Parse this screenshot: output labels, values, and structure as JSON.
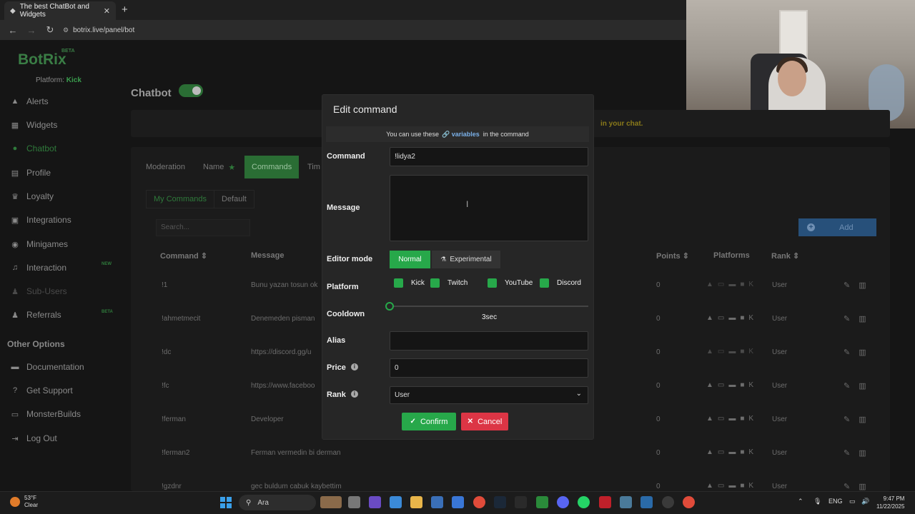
{
  "browser": {
    "tab_title": "The best ChatBot and Widgets",
    "url": "botrix.live/panel/bot"
  },
  "sidebar": {
    "logo": "BotRix",
    "beta": "BETA",
    "platform_label": "Platform:",
    "platform_value": "Kick",
    "items": [
      {
        "label": "Alerts",
        "icon": "warning-icon"
      },
      {
        "label": "Widgets",
        "icon": "grid-icon"
      },
      {
        "label": "Chatbot",
        "icon": "robot-icon"
      },
      {
        "label": "Profile",
        "icon": "id-card-icon"
      },
      {
        "label": "Loyalty",
        "icon": "trophy-icon"
      },
      {
        "label": "Integrations",
        "icon": "integrations-icon"
      },
      {
        "label": "Minigames",
        "icon": "gamepad-icon"
      },
      {
        "label": "Interaction",
        "icon": "music-icon"
      },
      {
        "label": "Sub-Users",
        "icon": "users-icon"
      },
      {
        "label": "Referrals",
        "icon": "referrals-icon"
      }
    ],
    "interaction_tag": "NEW",
    "referrals_tag": "BETA",
    "other_heading": "Other Options",
    "other_items": [
      {
        "label": "Documentation",
        "icon": "book-icon"
      },
      {
        "label": "Get Support",
        "icon": "question-icon"
      },
      {
        "label": "MonsterBuilds",
        "icon": "monitor-icon"
      },
      {
        "label": "Log Out",
        "icon": "logout-icon"
      }
    ]
  },
  "content": {
    "title": "Chatbot",
    "banner_text": "in your chat.",
    "main_tabs": [
      "Moderation",
      "Name",
      "Commands",
      "Tim"
    ],
    "sub_tabs": [
      "My Commands",
      "Default"
    ],
    "search_placeholder": "Search...",
    "add_label": "Add",
    "columns": [
      "Command",
      "Message",
      "Points",
      "Platforms",
      "Rank"
    ],
    "rows": [
      {
        "command": "!1",
        "message": "Bunu yazan tosun ok",
        "points": "0",
        "rank": "User"
      },
      {
        "command": "!ahmetmecit",
        "message": "Denemeden pisman",
        "points": "0",
        "rank": "User"
      },
      {
        "command": "!dc",
        "message": "https://discord.gg/u",
        "points": "0",
        "rank": "User"
      },
      {
        "command": "!fc",
        "message": "https://www.faceboo",
        "points": "0",
        "rank": "User"
      },
      {
        "command": "!ferman",
        "message": "Developer",
        "points": "0",
        "rank": "User"
      },
      {
        "command": "!ferman2",
        "message": "Ferman vermedin bi derman",
        "points": "0",
        "rank": "User"
      },
      {
        "command": "!gzdnr",
        "message": "gec buldum cabuk kaybettim",
        "points": "0",
        "rank": "User"
      }
    ]
  },
  "modal": {
    "title": "Edit command",
    "var_note_pre": "You can use these",
    "var_note_link": "variables",
    "var_note_post": "in the command",
    "command_label": "Command",
    "command_value": "!lidya2",
    "message_label": "Message",
    "message_value": "",
    "editor_mode_label": "Editor mode",
    "editor_normal": "Normal",
    "editor_experimental": "Experimental",
    "platform_label": "Platform",
    "platforms": [
      "Kick",
      "Twitch",
      "YouTube",
      "Discord"
    ],
    "cooldown_label": "Cooldown",
    "cooldown_value": "3sec",
    "cooldown_fraction": 0.0,
    "alias_label": "Alias",
    "alias_value": "",
    "price_label": "Price",
    "price_value": "0",
    "rank_label": "Rank",
    "rank_value": "User",
    "confirm_label": "Confirm",
    "cancel_label": "Cancel"
  },
  "taskbar": {
    "temp": "53°F",
    "weather": "Clear",
    "search": "Ara",
    "lang": "ENG",
    "time": "9:47 PM",
    "date": "11/22/2025"
  },
  "colors": {
    "accent_green": "#27a84a",
    "danger_red": "#dc3545",
    "link_blue": "#7ab0e8"
  }
}
